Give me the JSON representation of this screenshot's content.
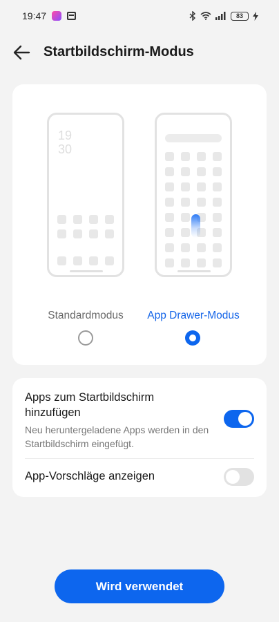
{
  "status_bar": {
    "time": "19:47",
    "battery": "83",
    "icons": [
      "app-notification-icon",
      "calendar-notification-icon",
      "bluetooth-icon",
      "wifi-icon",
      "signal-icon",
      "battery-icon",
      "charging-icon"
    ]
  },
  "header": {
    "title": "Startbildschirm-Modus",
    "back_icon": "arrow-left-icon"
  },
  "mode_preview": {
    "standard": {
      "label": "Standardmodus",
      "clock_hour": "19",
      "clock_minute": "30",
      "selected": false
    },
    "drawer": {
      "label": "App Drawer-Modus",
      "selected": true
    }
  },
  "settings": {
    "add_apps": {
      "title": "Apps zum Startbildschirm hinzufügen",
      "subtitle": "Neu heruntergeladene Apps werden in den Startbildschirm eingefügt.",
      "enabled": true
    },
    "suggestions": {
      "title": "App-Vorschläge anzeigen",
      "enabled": false
    }
  },
  "cta": {
    "label": "Wird verwendet"
  },
  "colors": {
    "accent": "#0d66ee",
    "background": "#f3f3f3",
    "card": "#ffffff"
  }
}
